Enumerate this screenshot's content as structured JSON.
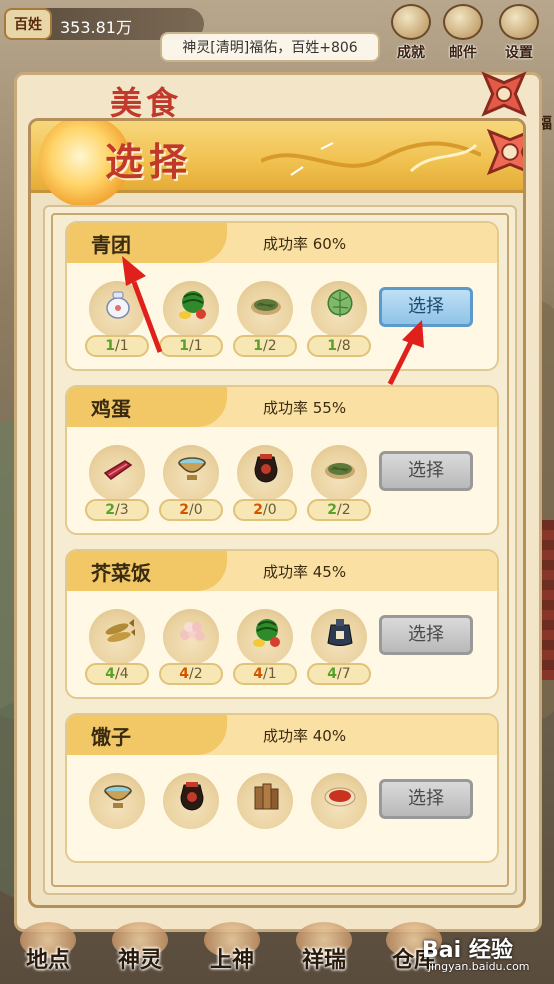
{
  "top_bar": {
    "currency_icon": "百姓",
    "currency_value": "353.81万",
    "notice": "神灵[清明]福佑，百姓+806",
    "buttons": [
      {
        "label": "成就",
        "icon": "achievement-icon"
      },
      {
        "label": "邮件",
        "icon": "mail-icon"
      },
      {
        "label": "设置",
        "icon": "settings-icon"
      }
    ],
    "side_tag": "福"
  },
  "back_panel": {
    "title": "美食"
  },
  "dialog": {
    "title": "选择",
    "recipes": [
      {
        "name": "青团",
        "rate": "成功率 60%",
        "button": "选择",
        "button_state": "active",
        "ingredients": [
          {
            "icon": "teapot-icon",
            "have": "1",
            "need": "1",
            "enough": true
          },
          {
            "icon": "watermelon-icon",
            "have": "1",
            "need": "1",
            "enough": true
          },
          {
            "icon": "tea-leaves-icon",
            "have": "1",
            "need": "2",
            "enough": true
          },
          {
            "icon": "lotus-leaf-icon",
            "have": "1",
            "need": "8",
            "enough": true
          }
        ]
      },
      {
        "name": "鸡蛋",
        "rate": "成功率 55%",
        "button": "选择",
        "button_state": "disabled",
        "ingredients": [
          {
            "icon": "meat-icon",
            "have": "2",
            "need": "3",
            "enough": true
          },
          {
            "icon": "water-bowl-icon",
            "have": "2",
            "need": "0",
            "enough": false
          },
          {
            "icon": "wine-jar-icon",
            "have": "2",
            "need": "0",
            "enough": false
          },
          {
            "icon": "tea-leaves-icon",
            "have": "2",
            "need": "2",
            "enough": true
          }
        ]
      },
      {
        "name": "芥菜饭",
        "rate": "成功率 45%",
        "button": "选择",
        "button_state": "disabled",
        "ingredients": [
          {
            "icon": "fish-icon",
            "have": "4",
            "need": "4",
            "enough": true
          },
          {
            "icon": "rice-balls-icon",
            "have": "4",
            "need": "2",
            "enough": false
          },
          {
            "icon": "watermelon-icon",
            "have": "4",
            "need": "1",
            "enough": false
          },
          {
            "icon": "oil-jar-icon",
            "have": "4",
            "need": "7",
            "enough": true
          }
        ]
      },
      {
        "name": "馓子",
        "rate": "成功率 40%",
        "button": "选择",
        "button_state": "disabled",
        "ingredients": [
          {
            "icon": "water-bowl-icon",
            "have": "",
            "need": "",
            "enough": true
          },
          {
            "icon": "wine-jar-icon",
            "have": "",
            "need": "",
            "enough": true
          },
          {
            "icon": "firewood-icon",
            "have": "",
            "need": "",
            "enough": true
          },
          {
            "icon": "sauce-dish-icon",
            "have": "",
            "need": "",
            "enough": true
          }
        ]
      }
    ]
  },
  "bottom_nav": [
    {
      "label": "地点"
    },
    {
      "label": "神灵"
    },
    {
      "label": "上神"
    },
    {
      "label": "祥瑞"
    },
    {
      "label": "仓库"
    }
  ],
  "watermark": {
    "brand": "Bai 经验",
    "url": "jingyan.baidu.com"
  },
  "colors": {
    "title_red": "#c0392b",
    "ok_green": "#5aa02c",
    "short_orange": "#d35400",
    "active_blue": "#8ec3e8"
  }
}
